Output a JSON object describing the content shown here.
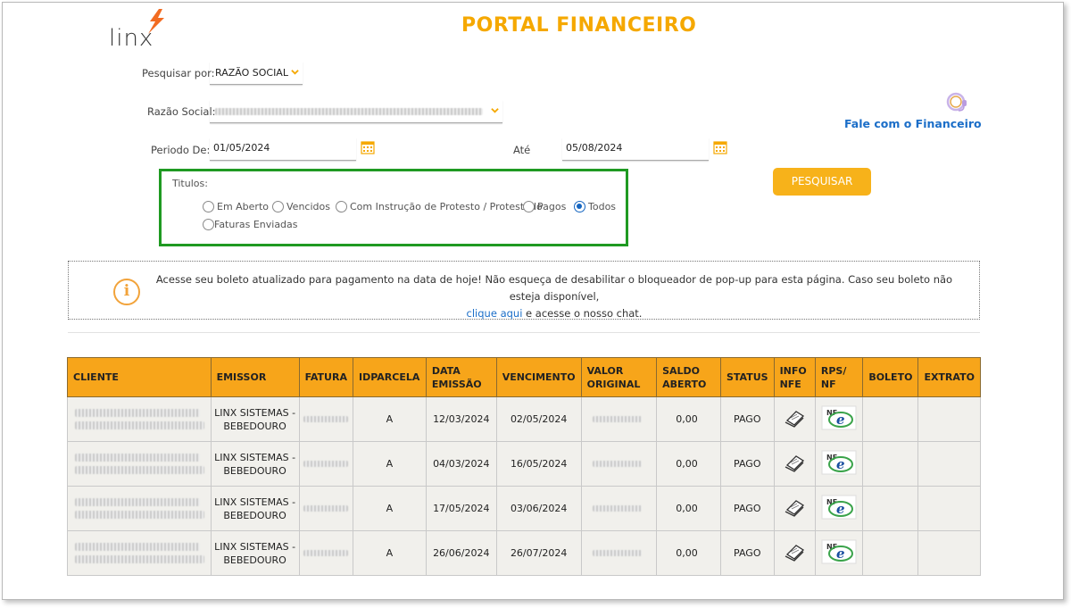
{
  "header": {
    "logo_text": "linx",
    "title": "PORTAL FINANCEIRO"
  },
  "form": {
    "pesquisar_label": "Pesquisar por:",
    "pesquisar_value": "RAZÃO SOCIAL",
    "razao_label": "Razão Social:",
    "periodo_label": "Periodo  De:",
    "periodo_de": "01/05/2024",
    "ate_label": "Até",
    "periodo_ate": "05/08/2024",
    "titulos_label": "Titulos:",
    "titulos_options": [
      "Em Aberto",
      "Vencidos",
      "Com Instrução de Protesto / Protestado",
      "Pagos",
      "Todos",
      "Faturas Enviadas"
    ],
    "titulos_selected": "Todos",
    "search_button": "PESQUISAR"
  },
  "support": {
    "link_label": "Fale com o Financeiro"
  },
  "notice": {
    "line1": "Acesse seu boleto atualizado para pagamento na data de hoje! Não esqueça de desabilitar o bloqueador de pop-up para esta página. Caso seu boleto não esteja disponível,",
    "link_text": "clique aqui",
    "line2_rest": " e acesse o nosso chat."
  },
  "table": {
    "headers": [
      "CLIENTE",
      "EMISSOR",
      "FATURA",
      "IDPARCELA",
      "DATA EMISSÃO",
      "VENCIMENTO",
      "VALOR ORIGINAL",
      "SALDO ABERTO",
      "STATUS",
      "INFO NFE",
      "RPS/ NF",
      "BOLETO",
      "EXTRATO"
    ],
    "rows": [
      {
        "emissor_line1": "LINX SISTEMAS -",
        "emissor_line2": "BEBEDOURO",
        "idparcela": "A",
        "data_emissao": "12/03/2024",
        "vencimento": "02/05/2024",
        "saldo_aberto": "0,00",
        "status": "PAGO"
      },
      {
        "emissor_line1": "LINX SISTEMAS -",
        "emissor_line2": "BEBEDOURO",
        "idparcela": "A",
        "data_emissao": "04/03/2024",
        "vencimento": "16/05/2024",
        "saldo_aberto": "0,00",
        "status": "PAGO"
      },
      {
        "emissor_line1": "LINX SISTEMAS -",
        "emissor_line2": "BEBEDOURO",
        "idparcela": "A",
        "data_emissao": "17/05/2024",
        "vencimento": "03/06/2024",
        "saldo_aberto": "0,00",
        "status": "PAGO"
      },
      {
        "emissor_line1": "LINX SISTEMAS -",
        "emissor_line2": "BEBEDOURO",
        "idparcela": "A",
        "data_emissao": "26/06/2024",
        "vencimento": "26/07/2024",
        "saldo_aberto": "0,00",
        "status": "PAGO"
      }
    ]
  },
  "icons": {
    "logo": "linx-logo-icon",
    "support": "headset-icon",
    "calendar": "calendar-icon",
    "info": "info-icon",
    "nfe_info": "document-stack-icon",
    "rps_nf": "nfe-logo-icon"
  },
  "colors": {
    "accent": "#f5a800",
    "table_header": "#f7a51a",
    "link": "#1b6ec8",
    "highlight_box": "#1f9a22",
    "button": "#f7b21a"
  }
}
